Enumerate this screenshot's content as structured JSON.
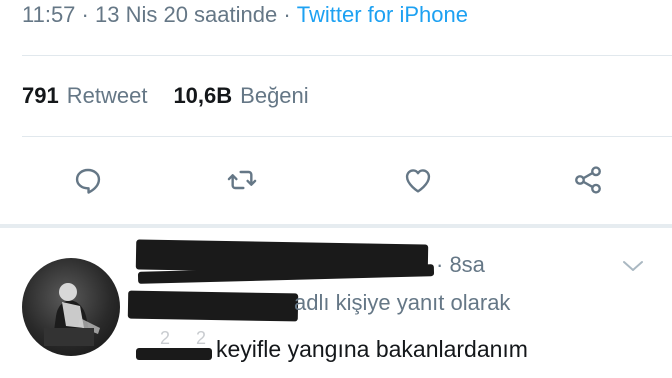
{
  "tweet": {
    "time": "11:57",
    "date": "13 Nis 20 saatinde",
    "separator": " · ",
    "source": "Twitter for iPhone"
  },
  "stats": {
    "retweet_count": "791",
    "retweet_label": "Retweet",
    "like_count": "10,6B",
    "like_label": "Beğeni"
  },
  "actions": [
    "reply-icon",
    "retweet-icon",
    "like-icon",
    "share-icon"
  ],
  "reply": {
    "time": "· 8sa",
    "replying_to": "adlı kişiye yanıt olarak",
    "text": "keyifle yangına bakanlardanım"
  },
  "colors": {
    "accent": "#1da1f2",
    "secondary_text": "#657786",
    "divider": "#e1e8ed"
  }
}
